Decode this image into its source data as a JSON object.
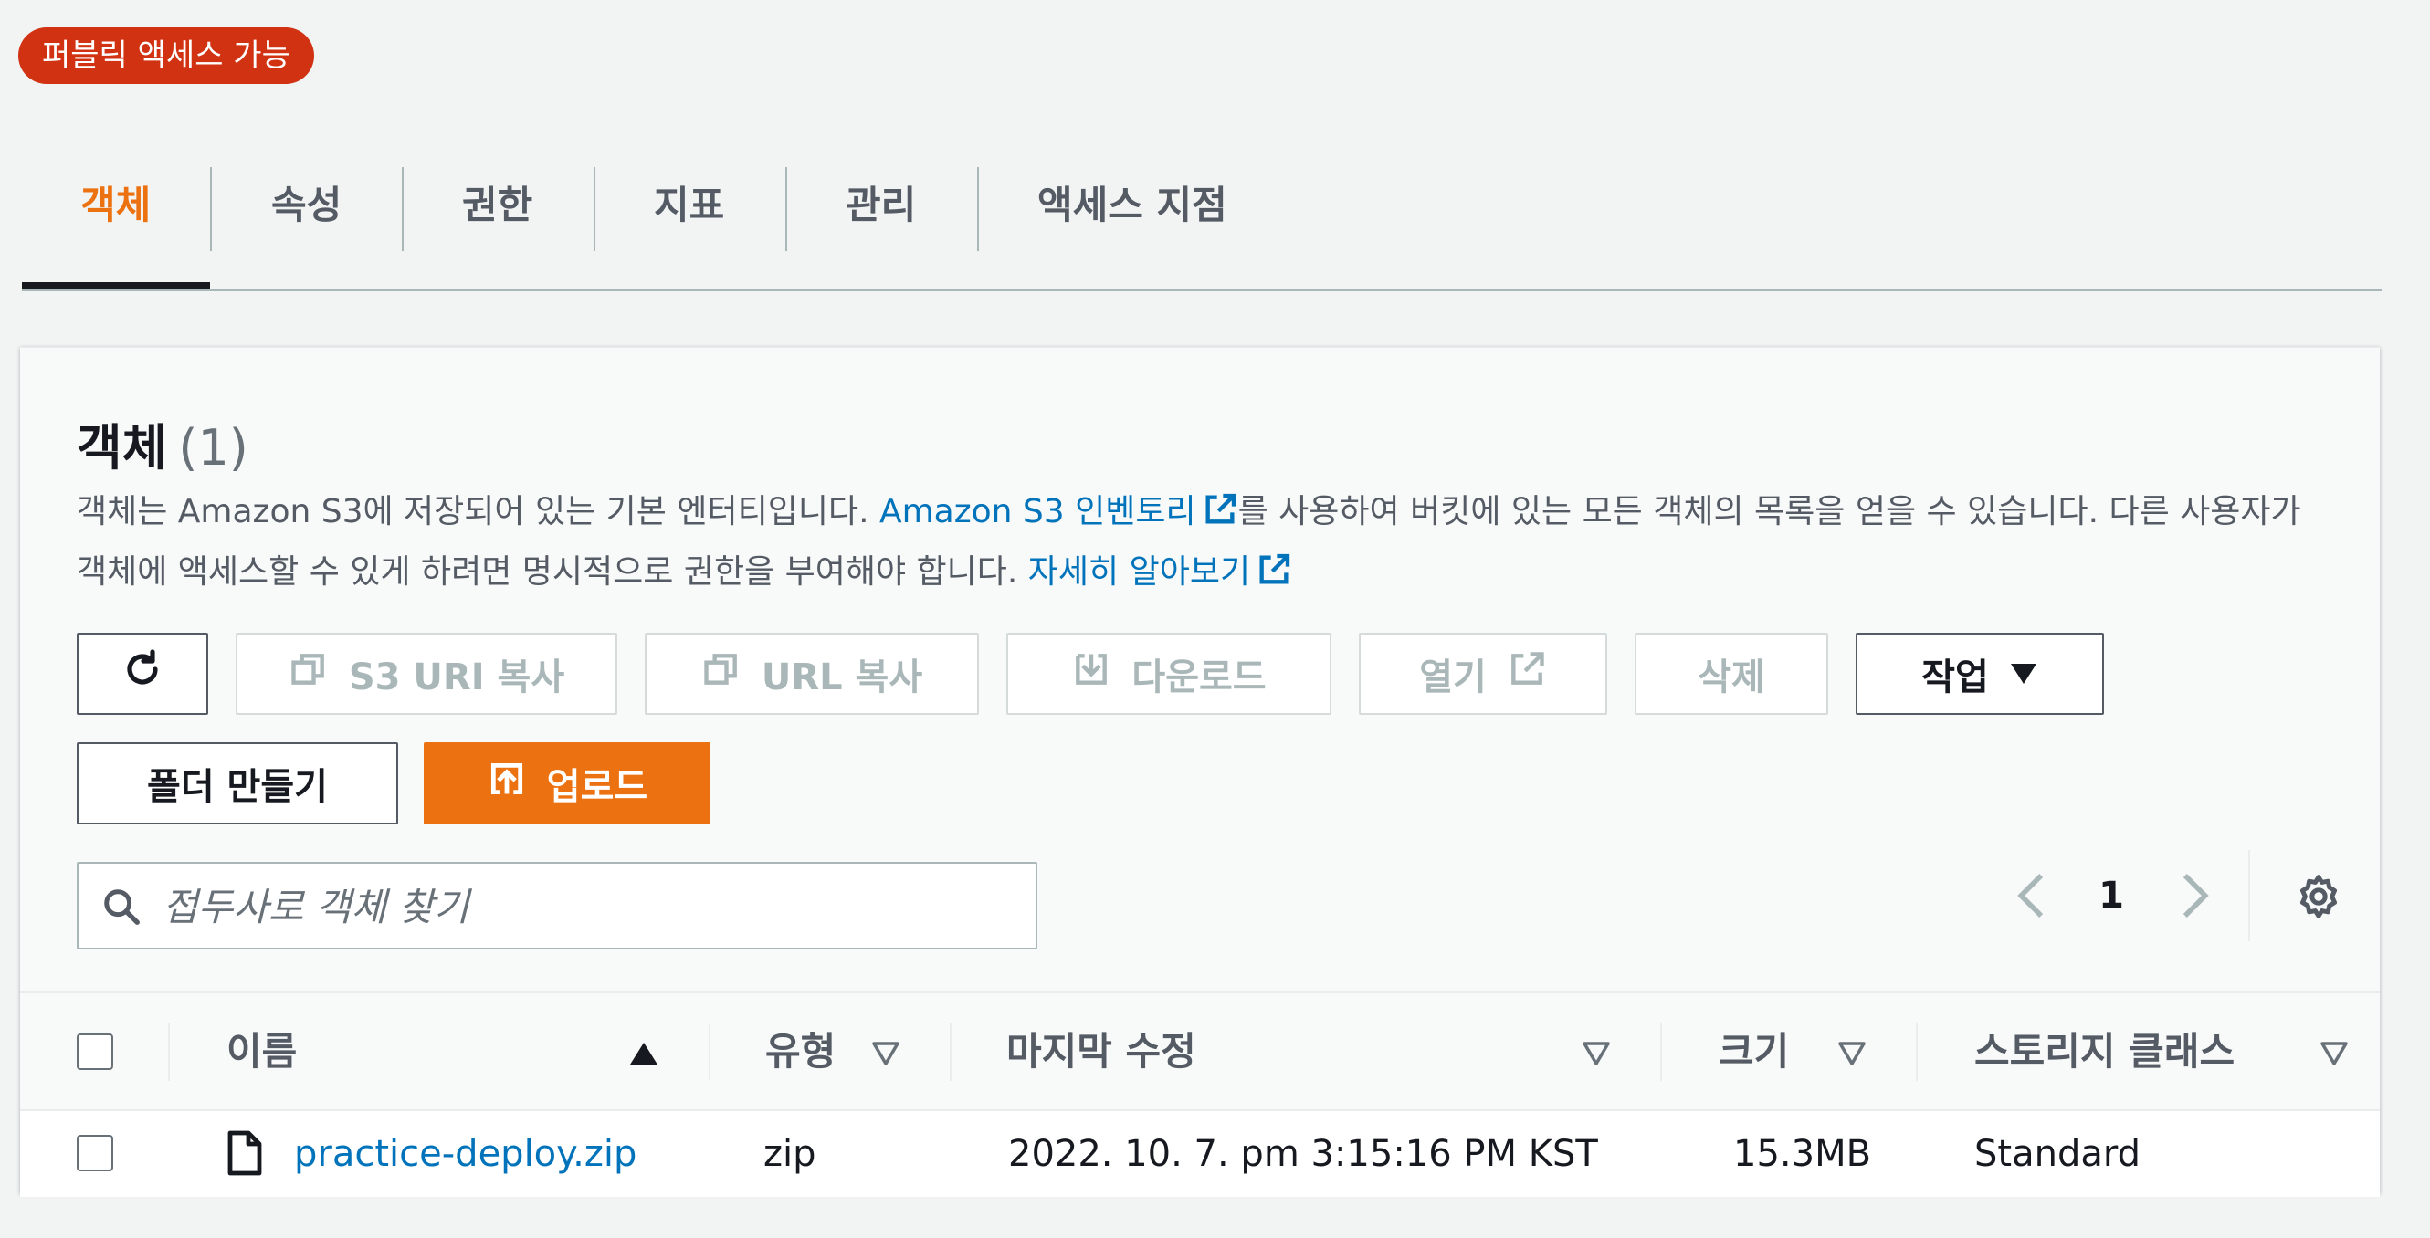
{
  "badge": "퍼블릭 액세스 가능",
  "tabs": [
    {
      "label": "객체"
    },
    {
      "label": "속성"
    },
    {
      "label": "권한"
    },
    {
      "label": "지표"
    },
    {
      "label": "관리"
    },
    {
      "label": "액세스 지점"
    }
  ],
  "panel": {
    "title": "객체",
    "count": "(1)",
    "desc_part1": "객체는 Amazon S3에 저장되어 있는 기본 엔터티입니다. ",
    "desc_link1": "Amazon S3 인벤토리",
    "desc_part2": "를 사용하여 버킷에 있는 모든 객체의 목록을 얻을 수 있습니다. 다른 사용자가 객체에 액세스할 수 있게 하려면 명시적으로 권한을 부여해야 합니다. ",
    "desc_link2": "자세히 알아보기"
  },
  "toolbar": {
    "copy_s3_uri": "S3 URI 복사",
    "copy_url": "URL 복사",
    "download": "다운로드",
    "open": "열기",
    "delete": "삭제",
    "actions": "작업",
    "create_folder": "폴더 만들기",
    "upload": "업로드"
  },
  "search": {
    "placeholder": "접두사로 객체 찾기"
  },
  "pagination": {
    "current_page": "1"
  },
  "table": {
    "columns": [
      "이름",
      "유형",
      "마지막 수정",
      "크기",
      "스토리지 클래스"
    ],
    "rows": [
      {
        "name": "practice-deploy.zip",
        "type": "zip",
        "last_modified": "2022. 10. 7. pm 3:15:16 PM KST",
        "size": "15.3MB",
        "storage_class": "Standard"
      }
    ]
  },
  "colors": {
    "accent": "#ec7211",
    "link": "#0073bb",
    "badge_bg": "#d13212"
  }
}
